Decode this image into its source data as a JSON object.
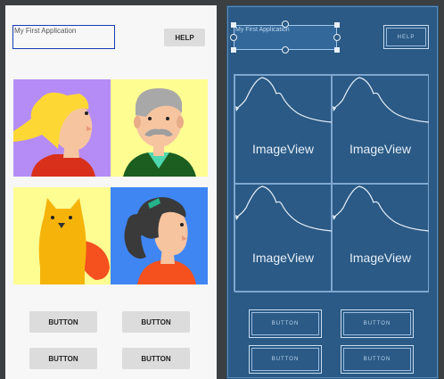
{
  "design": {
    "title_text": "My First Application",
    "help_label": "HELP",
    "images": [
      {
        "name": "blonde-woman-avatar",
        "bg": "#b58cf6"
      },
      {
        "name": "old-man-avatar",
        "bg": "#fdfd92"
      },
      {
        "name": "cat-avatar",
        "bg": "#fdfd92"
      },
      {
        "name": "ponytail-girl-avatar",
        "bg": "#3f86f3"
      }
    ],
    "buttons": [
      "BUTTON",
      "BUTTON",
      "BUTTON",
      "BUTTON"
    ]
  },
  "blueprint": {
    "title_text": "My First Application",
    "help_label": "HELP",
    "image_label": "ImageView",
    "buttons": [
      "BUTTON",
      "BUTTON",
      "BUTTON",
      "BUTTON"
    ]
  },
  "colors": {
    "blueprint_bg": "#2a5a85",
    "design_bg": "#f7f7f7",
    "selection": "#1a3bb3"
  }
}
